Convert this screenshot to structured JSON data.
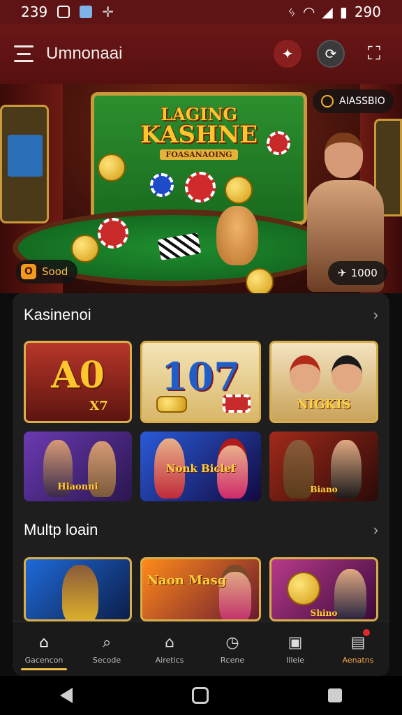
{
  "status_bar": {
    "time": "239",
    "battery": "290"
  },
  "app_bar": {
    "title": "Umnonaai"
  },
  "hero": {
    "logo_line1": "LAGING",
    "logo_line2": "KASHNE",
    "logo_line3": "FOASANAOING",
    "badge_top_right": "AIASSBIO",
    "badge_left": "Sood",
    "badge_right": "1000"
  },
  "sections": [
    {
      "title": "Kasinenoi"
    },
    {
      "title": "Multp loain"
    }
  ],
  "tiles_row1": [
    {
      "main": "A0",
      "sub": "X7"
    },
    {
      "main": "107",
      "sub": ""
    },
    {
      "main": "",
      "sub": "NIGKIS"
    }
  ],
  "tiles_row2": [
    {
      "sub": "Hiaonni"
    },
    {
      "sub": "Nonk Biclef"
    },
    {
      "sub": "Biano"
    }
  ],
  "tiles_row3": [
    {
      "sub": ""
    },
    {
      "sub": "Naon Masg"
    },
    {
      "sub": "Shino"
    }
  ],
  "tabs": [
    {
      "label": "Gacencon",
      "icon": "home-icon"
    },
    {
      "label": "Secode",
      "icon": "search-icon"
    },
    {
      "label": "Airetics",
      "icon": "bell-icon"
    },
    {
      "label": "Rcene",
      "icon": "clock-icon"
    },
    {
      "label": "Illeie",
      "icon": "id-card-icon"
    },
    {
      "label": "Aenatns",
      "icon": "gift-icon"
    }
  ],
  "colors": {
    "accent": "#f2c14a",
    "app_bar": "#5e1414",
    "panel": "#1e1e1e"
  }
}
